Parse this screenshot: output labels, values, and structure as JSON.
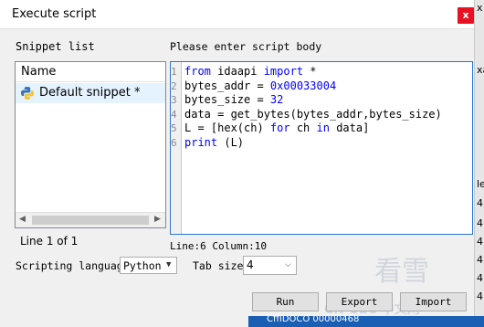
{
  "window": {
    "title": "Execute script",
    "close_label": "x"
  },
  "right_edge": {
    "labels": [
      "x",
      "xa",
      "le",
      "4",
      "4",
      "4",
      "4",
      "4",
      "4",
      "4",
      "4"
    ]
  },
  "snippets": {
    "section_label": "Snippet list",
    "column_header": "Name",
    "items": [
      {
        "label": "Default snippet *",
        "icon": "python-icon"
      }
    ],
    "status": "Line 1 of 1"
  },
  "editor": {
    "section_label": "Please enter script body",
    "line_numbers": [
      "1",
      "2",
      "3",
      "4",
      "5",
      "6"
    ],
    "lines": [
      [
        {
          "t": "from",
          "c": "kw"
        },
        {
          "t": " idaapi ",
          "c": "txt"
        },
        {
          "t": "import",
          "c": "kw"
        },
        {
          "t": " *",
          "c": "txt"
        }
      ],
      [
        {
          "t": "bytes_addr = ",
          "c": "txt"
        },
        {
          "t": "0x00033004",
          "c": "num"
        }
      ],
      [
        {
          "t": "bytes_size = ",
          "c": "txt"
        },
        {
          "t": "32",
          "c": "num"
        }
      ],
      [
        {
          "t": "data = get_bytes(bytes_addr,bytes_size)",
          "c": "txt"
        }
      ],
      [
        {
          "t": "L = [hex(ch) ",
          "c": "txt"
        },
        {
          "t": "for",
          "c": "kw"
        },
        {
          "t": " ch ",
          "c": "txt"
        },
        {
          "t": "in",
          "c": "kw"
        },
        {
          "t": " data]",
          "c": "txt"
        }
      ],
      [
        {
          "t": "print",
          "c": "kw"
        },
        {
          "t": " (L)",
          "c": "txt"
        }
      ]
    ],
    "status": "Line:6  Column:10"
  },
  "options": {
    "language_label": "Scripting language",
    "language_value": "Python",
    "tab_label": "Tab size",
    "tab_value": "4"
  },
  "buttons": {
    "run": "Run",
    "export": "Export",
    "import": "Import"
  },
  "background": {
    "watermark_chars": "看雪",
    "watermark_sub": "CN-SEC 中文网",
    "strip_text": "CffIDOCO 00000468"
  },
  "colors": {
    "accent": "#2e75c9",
    "keyword": "#0000ff",
    "close": "#e81123",
    "selection": "#e5f3ff"
  }
}
